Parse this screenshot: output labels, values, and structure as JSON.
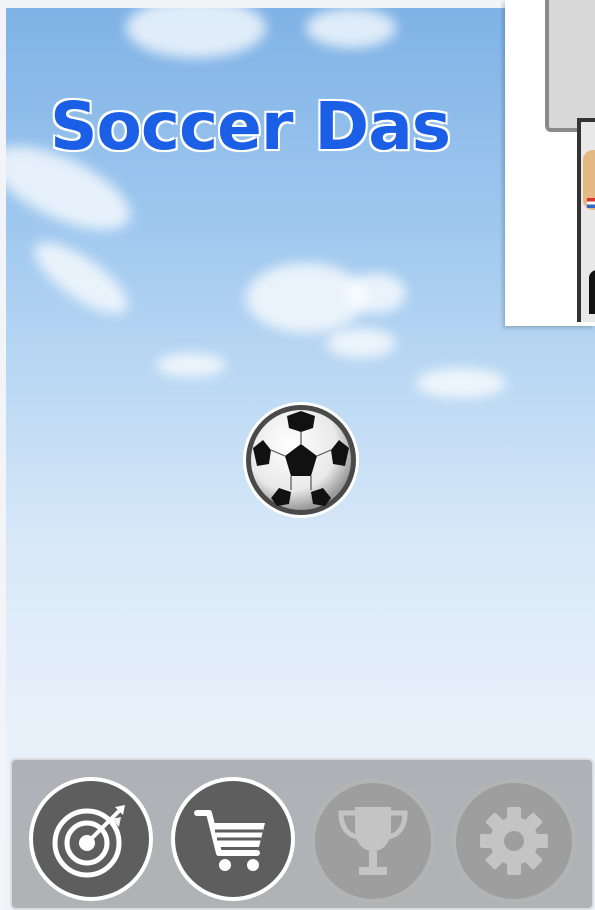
{
  "game": {
    "title": "Soccer Das"
  },
  "main": {
    "ball_icon": "soccer-ball-icon"
  },
  "ad": {
    "icon": "advertisement-image"
  },
  "bottom_bar": {
    "buttons": [
      {
        "name": "target",
        "icon": "target-icon",
        "state": "active"
      },
      {
        "name": "shop",
        "icon": "shopping-cart-icon",
        "state": "active"
      },
      {
        "name": "trophy",
        "icon": "trophy-icon",
        "state": "disabled"
      },
      {
        "name": "settings",
        "icon": "gear-icon",
        "state": "disabled"
      }
    ]
  },
  "colors": {
    "title": "#1a5fe6",
    "sky_top": "#7fb2e6",
    "sky_bottom": "#eef4fb",
    "button_active": "#5e5e5e",
    "button_disabled": "#9e9e9e"
  }
}
